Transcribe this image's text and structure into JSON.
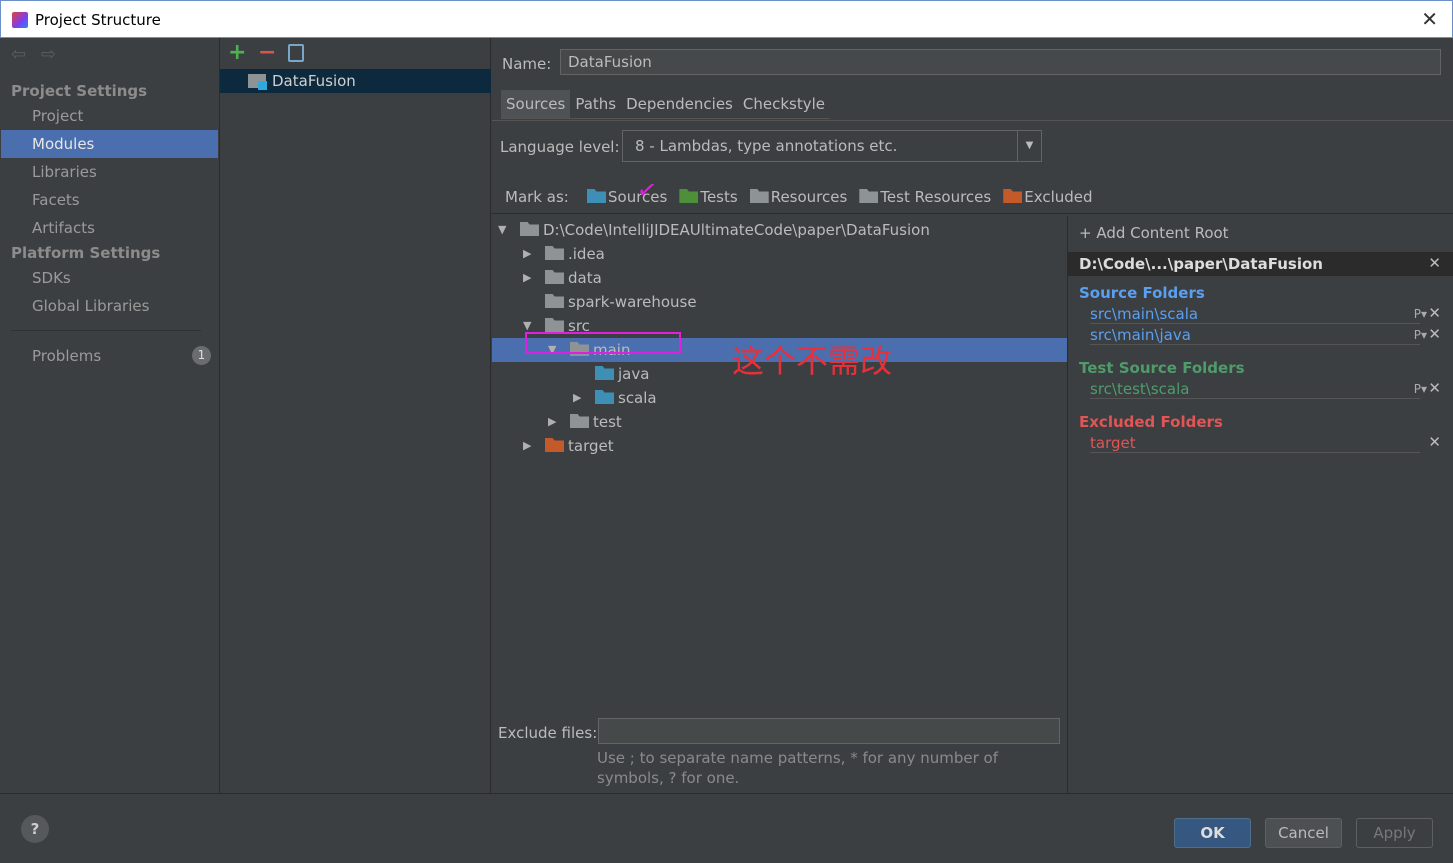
{
  "window": {
    "title": "Project Structure"
  },
  "sidebar": {
    "project_settings": "Project Settings",
    "items": [
      "Project",
      "Modules",
      "Libraries",
      "Facets",
      "Artifacts"
    ],
    "platform_settings": "Platform Settings",
    "platform_items": [
      "SDKs",
      "Global Libraries"
    ],
    "problems": "Problems",
    "problems_count": "1"
  },
  "modules": {
    "items": [
      "DataFusion"
    ]
  },
  "main": {
    "name_label": "Name:",
    "name_value": "DataFusion",
    "tabs": [
      "Sources",
      "Paths",
      "Dependencies",
      "Checkstyle"
    ],
    "language_label": "Language level:",
    "language_value": "8 - Lambdas, type annotations etc.",
    "mark_as": "Mark as:",
    "marks": [
      {
        "label": "Sources",
        "color": "#3d8fb5"
      },
      {
        "label": "Tests",
        "color": "#4e8f3a"
      },
      {
        "label": "Resources",
        "color": "#8e9396"
      },
      {
        "label": "Test Resources",
        "color": "#8e9396"
      },
      {
        "label": "Excluded",
        "color": "#c45a2a"
      }
    ],
    "tree": [
      {
        "label": "D:\\Code\\IntelliJIDEAUltimateCode\\paper\\DataFusion",
        "depth": 0,
        "arrow": "down",
        "color": "#8e9396"
      },
      {
        "label": ".idea",
        "depth": 1,
        "arrow": "right",
        "color": "#8e9396"
      },
      {
        "label": "data",
        "depth": 1,
        "arrow": "right",
        "color": "#8e9396"
      },
      {
        "label": "spark-warehouse",
        "depth": 1,
        "arrow": "",
        "color": "#8e9396"
      },
      {
        "label": "src",
        "depth": 1,
        "arrow": "down",
        "color": "#8e9396"
      },
      {
        "label": "main",
        "depth": 2,
        "arrow": "down",
        "color": "#8e9396",
        "selected": true
      },
      {
        "label": "java",
        "depth": 3,
        "arrow": "",
        "color": "#3d8fb5"
      },
      {
        "label": "scala",
        "depth": 3,
        "arrow": "right",
        "color": "#3d8fb5"
      },
      {
        "label": "test",
        "depth": 2,
        "arrow": "right",
        "color": "#8e9396"
      },
      {
        "label": "target",
        "depth": 1,
        "arrow": "right",
        "color": "#c45a2a"
      }
    ],
    "annotation": "这个不需改",
    "exclude_label": "Exclude files:",
    "exclude_value": "",
    "exclude_hint": "Use ; to separate name patterns, * for any number of symbols, ? for one."
  },
  "content_root": {
    "add": "Add Content Root",
    "path": "D:\\Code\\...\\paper\\DataFusion",
    "source_title": "Source Folders",
    "sources": [
      "src\\main\\scala",
      "src\\main\\java"
    ],
    "test_title": "Test Source Folders",
    "tests": [
      "src\\test\\scala"
    ],
    "excluded_title": "Excluded Folders",
    "excluded": [
      "target"
    ],
    "colors": {
      "source": "#5a9ff0",
      "test": "#4f9c6a",
      "excluded": "#e05555"
    }
  },
  "buttons": {
    "ok": "OK",
    "cancel": "Cancel",
    "apply": "Apply",
    "help": "?"
  }
}
